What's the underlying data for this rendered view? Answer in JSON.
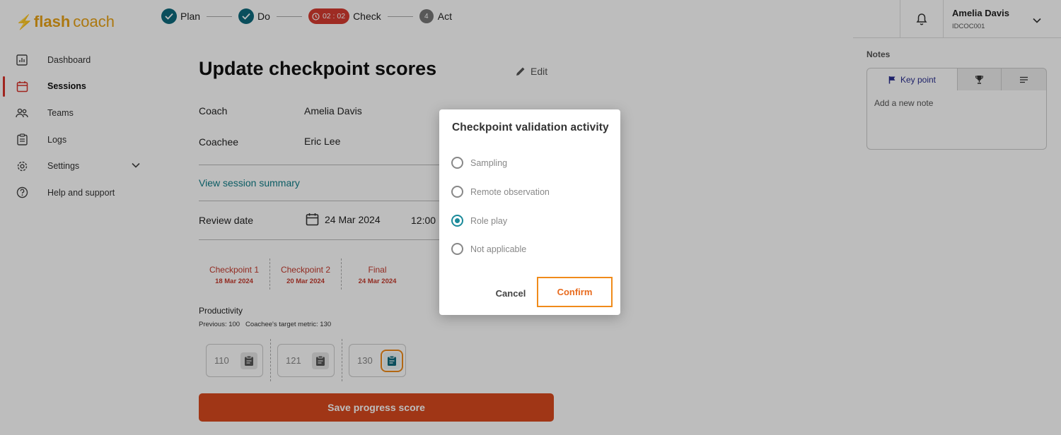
{
  "brand": {
    "flash": "flash",
    "coach": "coach"
  },
  "sidebar": {
    "items": [
      {
        "label": "Dashboard",
        "icon": "chart-icon"
      },
      {
        "label": "Sessions",
        "icon": "calendar-icon",
        "active": true
      },
      {
        "label": "Teams",
        "icon": "people-icon"
      },
      {
        "label": "Logs",
        "icon": "clipboard-icon"
      },
      {
        "label": "Settings",
        "icon": "gear-icon"
      },
      {
        "label": "Help and support",
        "icon": "help-icon"
      }
    ]
  },
  "stepper": {
    "plan": "Plan",
    "do": "Do",
    "timer": "02 : 02",
    "check": "Check",
    "act_number": "4",
    "act": "Act"
  },
  "page": {
    "title": "Update checkpoint scores",
    "edit_label": "Edit",
    "coach_label": "Coach",
    "coach_value": "Amelia Davis",
    "coachee_label": "Coachee",
    "coachee_value": "Eric Lee",
    "view_summary": "View session summary",
    "review_date_label": "Review date",
    "review_date_value": "24 Mar 2024",
    "review_time_value": "12:00"
  },
  "checkpoints": [
    {
      "name": "Checkpoint 1",
      "date": "18 Mar 2024"
    },
    {
      "name": "Checkpoint 2",
      "date": "20 Mar 2024"
    },
    {
      "name": "Final",
      "date": "24 Mar 2024"
    }
  ],
  "productivity": {
    "label": "Productivity",
    "sub": "Previous: 100   Coachee's target metric: 130",
    "scores": [
      "110",
      "121",
      "130"
    ]
  },
  "save_button": "Save progress score",
  "user": {
    "name": "Amelia Davis",
    "id": "IDCOC001"
  },
  "notes": {
    "label": "Notes",
    "tab_key_point": "Key point",
    "placeholder": "Add a new note"
  },
  "modal": {
    "title": "Checkpoint validation activity",
    "options": [
      "Sampling",
      "Remote observation",
      "Role play",
      "Not applicable"
    ],
    "selected": "Role play",
    "cancel": "Cancel",
    "confirm": "Confirm"
  },
  "colors": {
    "brand": "#e8a317",
    "teal": "#0e6a7d",
    "accent_red": "#d84a1e",
    "highlight": "#f08b1a"
  }
}
